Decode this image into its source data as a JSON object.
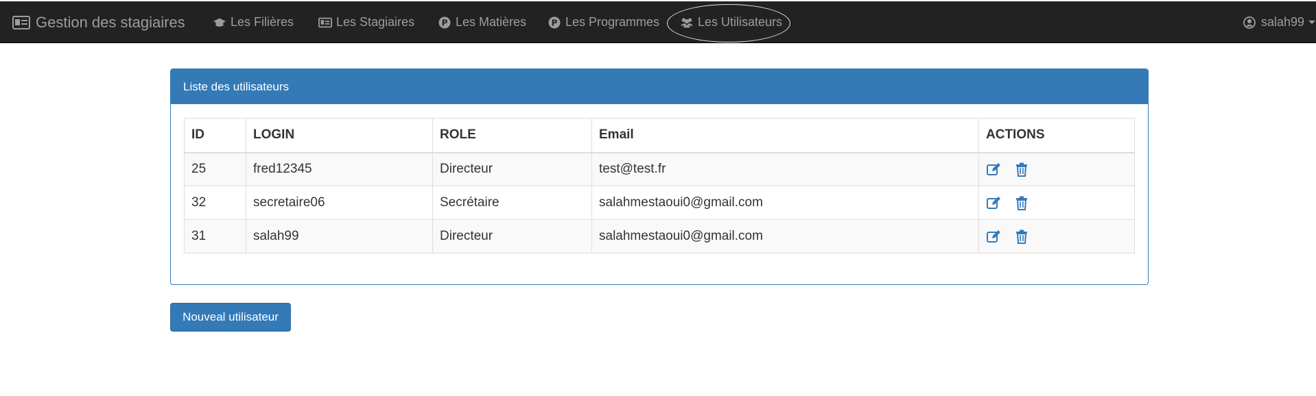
{
  "navbar": {
    "brand": "Gestion des stagiaires",
    "items": [
      {
        "label": "Les Filières",
        "icon": "graduation-cap-icon"
      },
      {
        "label": "Les Stagiaires",
        "icon": "id-card-icon"
      },
      {
        "label": "Les Matières",
        "icon": "p-circle-icon"
      },
      {
        "label": "Les Programmes",
        "icon": "p-circle-icon"
      },
      {
        "label": "Les Utilisateurs",
        "icon": "users-icon",
        "active": true
      }
    ],
    "user": "salah99"
  },
  "panel": {
    "title": "Liste des utilisateurs",
    "columns": [
      "ID",
      "LOGIN",
      "ROLE",
      "Email",
      "ACTIONS"
    ],
    "rows": [
      {
        "id": "25",
        "login": "fred12345",
        "role": "Directeur",
        "email": "test@test.fr"
      },
      {
        "id": "32",
        "login": "secretaire06",
        "role": "Secrétaire",
        "email": "salahmestaoui0@gmail.com"
      },
      {
        "id": "31",
        "login": "salah99",
        "role": "Directeur",
        "email": "salahmestaoui0@gmail.com"
      }
    ]
  },
  "new_button": "Nouveal utilisateur",
  "colors": {
    "navbar": "#222222",
    "nav_text": "#9d9d9d",
    "primary": "#337ab7",
    "stripe": "#f9f9f9"
  }
}
